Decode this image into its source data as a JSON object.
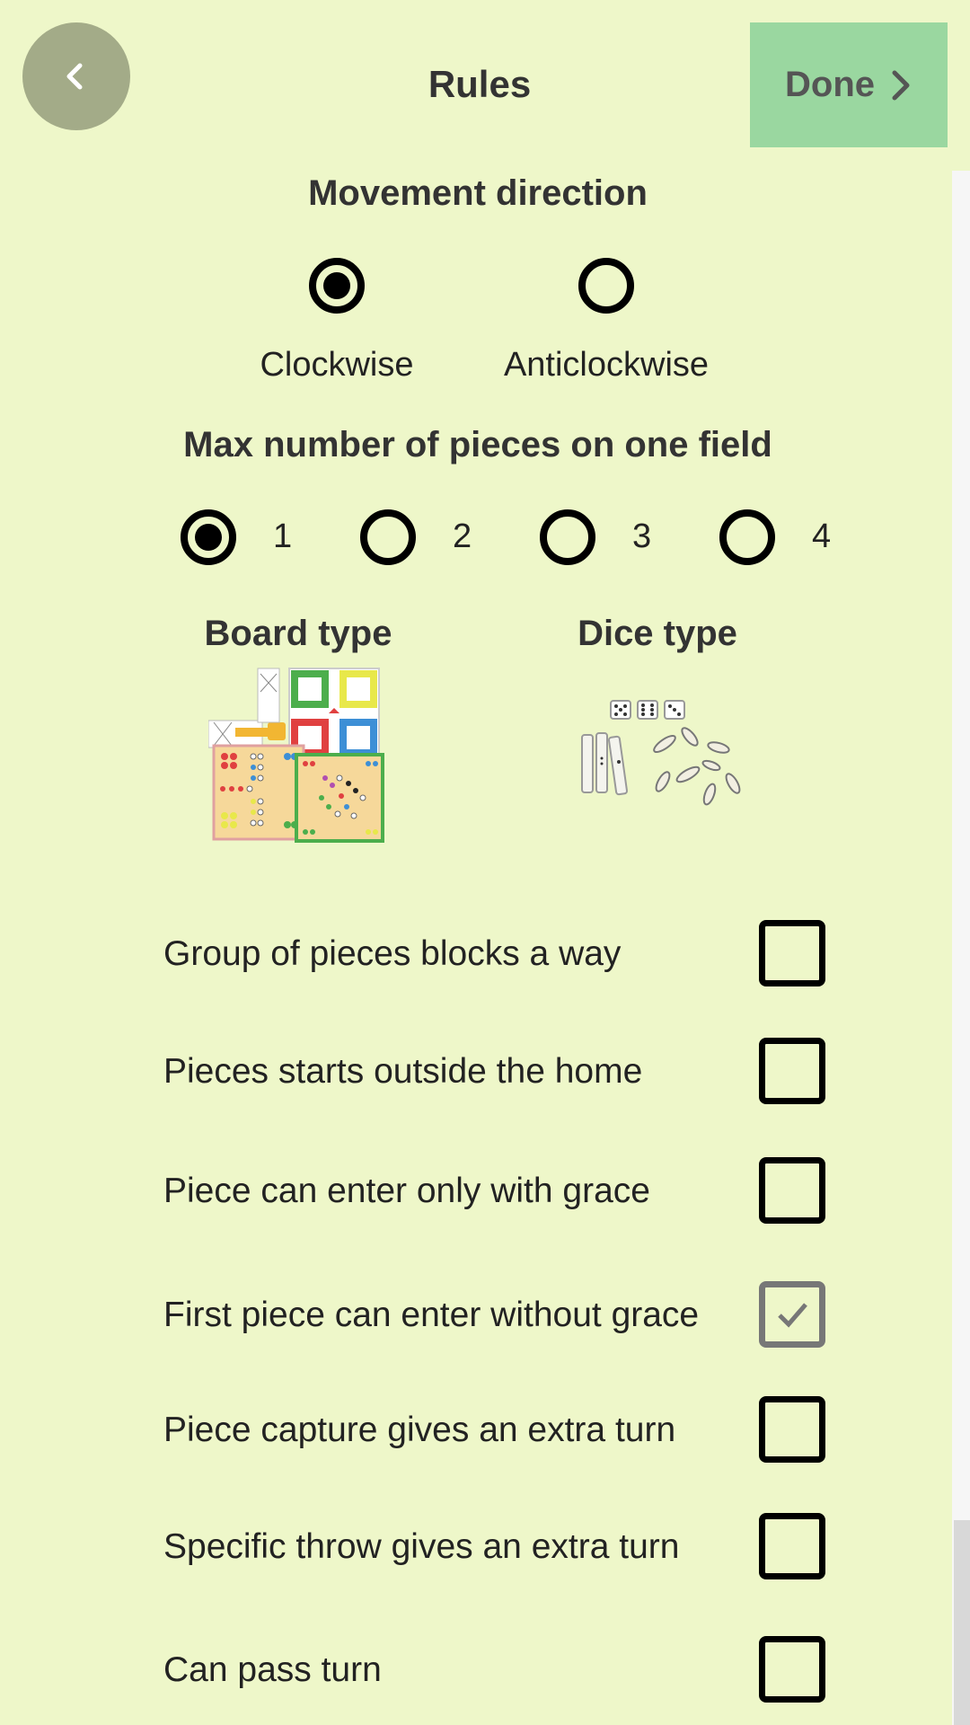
{
  "header": {
    "title": "Rules",
    "done_label": "Done"
  },
  "movement": {
    "title": "Movement direction",
    "options": [
      {
        "label": "Clockwise",
        "checked": true
      },
      {
        "label": "Anticlockwise",
        "checked": false
      }
    ]
  },
  "max_pieces": {
    "title": "Max number of pieces on one field",
    "options": [
      {
        "label": "1",
        "checked": true
      },
      {
        "label": "2",
        "checked": false
      },
      {
        "label": "3",
        "checked": false
      },
      {
        "label": "4",
        "checked": false
      }
    ]
  },
  "board": {
    "title": "Board type"
  },
  "dice": {
    "title": "Dice type"
  },
  "rules": [
    {
      "label": "Group of pieces blocks a way",
      "checked": false
    },
    {
      "label": "Pieces starts outside the home",
      "checked": false
    },
    {
      "label": "Piece can enter only with grace",
      "checked": false
    },
    {
      "label": "First piece can enter without grace",
      "checked": true
    },
    {
      "label": "Piece capture gives an extra turn",
      "checked": false
    },
    {
      "label": "Specific throw gives an extra turn",
      "checked": false
    },
    {
      "label": "Can pass turn",
      "checked": false
    }
  ],
  "colors": {
    "background": "#eef7c9",
    "done": "#9ad7a0",
    "back": "#a3ab88"
  }
}
